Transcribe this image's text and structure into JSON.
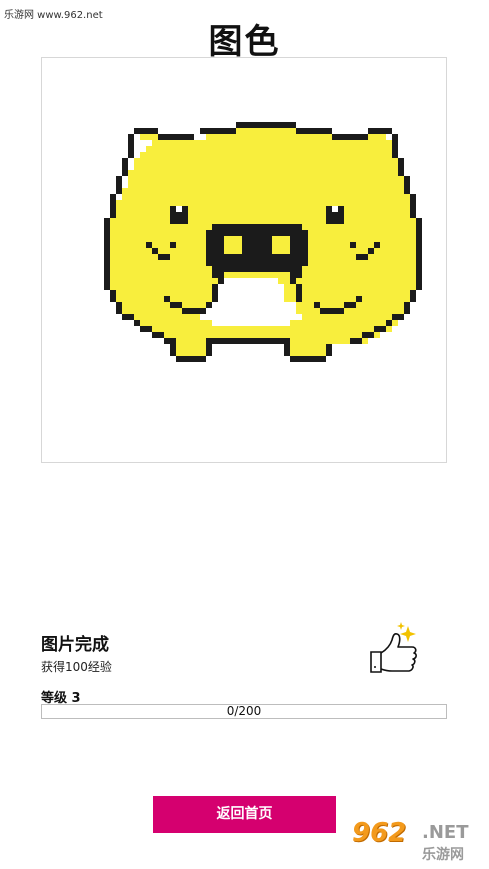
{
  "watermark": {
    "site": "乐游网 www.962.net",
    "logo_digits": "962",
    "logo_suffix": ".NET",
    "logo_sub": "乐游网"
  },
  "header": {
    "title": "图色"
  },
  "artwork": {
    "palette": {
      "yellow": "#f8ee3d",
      "black": "#1b1b1b",
      "white": "#ffffff"
    }
  },
  "result": {
    "title": "图片完成",
    "reward": "获得100经验"
  },
  "level": {
    "label": "等级 3",
    "progress_text": "0/200",
    "progress_fraction": 0
  },
  "actions": {
    "home_label": "返回首页"
  },
  "colors": {
    "accent": "#d5006f",
    "sparkle": "#f2c200"
  }
}
